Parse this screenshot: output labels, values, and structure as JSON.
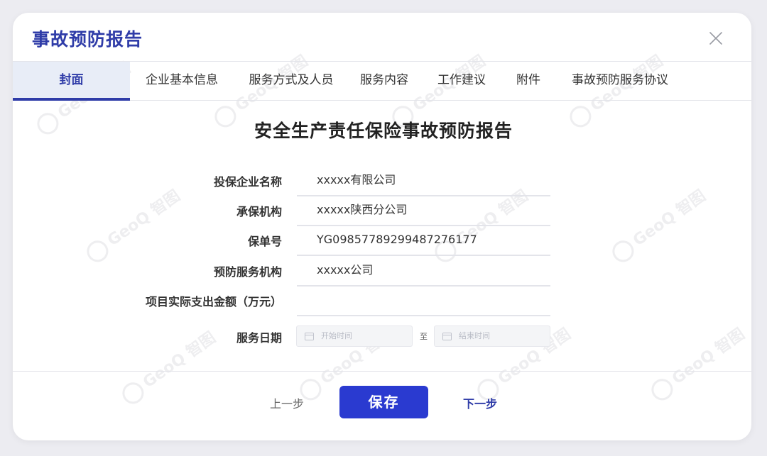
{
  "dialog": {
    "title": "事故预防报告"
  },
  "tabs": [
    {
      "label": "封面",
      "active": true
    },
    {
      "label": "企业基本信息",
      "active": false
    },
    {
      "label": "服务方式及人员",
      "active": false
    },
    {
      "label": "服务内容",
      "active": false
    },
    {
      "label": "工作建议",
      "active": false
    },
    {
      "label": "附件",
      "active": false
    },
    {
      "label": "事故预防服务协议",
      "active": false
    }
  ],
  "form": {
    "title": "安全生产责任保险事故预防报告",
    "fields": [
      {
        "label": "投保企业名称",
        "value": "xxxxx有限公司"
      },
      {
        "label": "承保机构",
        "value": "xxxxx陕西分公司"
      },
      {
        "label": "保单号",
        "value": "YG09857789299487276177"
      },
      {
        "label": "预防服务机构",
        "value": "xxxxx公司"
      },
      {
        "label": "项目实际支出金额（万元）",
        "value": ""
      }
    ],
    "service_date": {
      "label": "服务日期",
      "start_placeholder": "开始时间",
      "separator": "至",
      "end_placeholder": "结束时间"
    }
  },
  "footer": {
    "prev_label": "上一步",
    "save_label": "保存",
    "next_label": "下一步"
  },
  "watermark": {
    "text": "GeoQ 智图"
  },
  "colors": {
    "accent": "#2f3ca8",
    "primary_button": "#2a3ad0",
    "active_tab_bg": "#e8edf7",
    "page_bg": "#ececf1"
  }
}
